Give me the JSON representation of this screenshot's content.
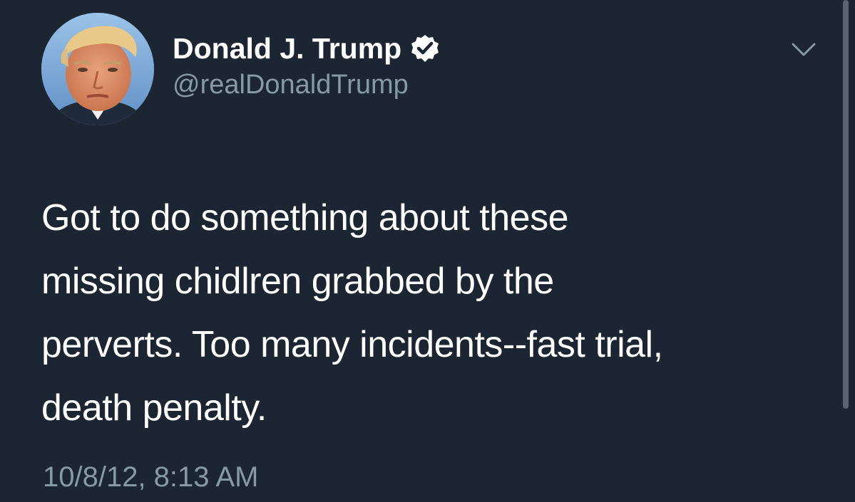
{
  "tweet": {
    "author": {
      "display_name": "Donald J. Trump",
      "handle": "@realDonaldTrump",
      "verified": true,
      "avatar_icon": "profile-photo"
    },
    "text": "Got to do something about these\nmissing chidlren grabbed by the\nperverts. Too many incidents--fast trial,\ndeath penalty.",
    "timestamp": "10/8/12, 8:13 AM",
    "menu_icon": "chevron-down-icon"
  },
  "colors": {
    "background": "#1c2532",
    "primary_text": "#ffffff",
    "secondary_text": "#8899a6",
    "verified_badge": "#ffffff"
  }
}
